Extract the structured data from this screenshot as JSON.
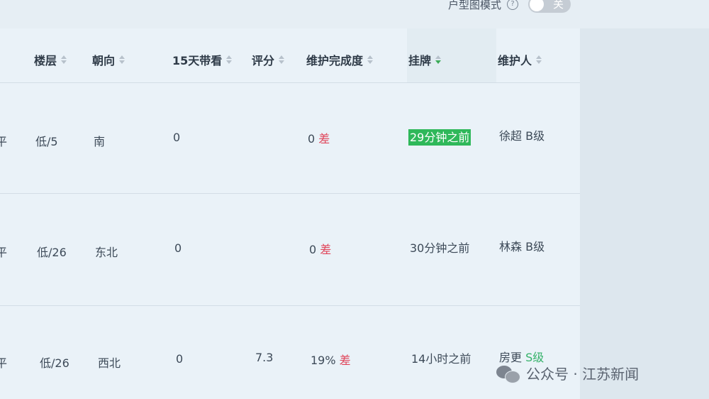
{
  "toolbar": {
    "floor_plan_mode_label": "户型图模式",
    "toggle_label": "关"
  },
  "table": {
    "headers": {
      "floor": "楼层",
      "orientation": "朝向",
      "views_15d": "15天带看",
      "score": "评分",
      "maintenance": "维护完成度",
      "listing": "挂牌",
      "maintainer": "维护人"
    },
    "rows": [
      {
        "left_fragment": "平",
        "floor": "低/5",
        "orientation": "南",
        "views_15d": "0",
        "score": "",
        "maint_value": "0",
        "maint_grade": "差",
        "listing": "29分钟之前",
        "maintainer_name": "徐超",
        "maintainer_grade": "B级"
      },
      {
        "left_fragment": "平",
        "floor": "低/26",
        "orientation": "东北",
        "views_15d": "0",
        "score": "",
        "maint_value": "0",
        "maint_grade": "差",
        "listing": "30分钟之前",
        "maintainer_name": "林森",
        "maintainer_grade": "B级"
      },
      {
        "left_fragment": "平",
        "floor": "低/26",
        "orientation": "西北",
        "views_15d": "0",
        "score": "7.3",
        "maint_value": "19%",
        "maint_grade": "差",
        "listing": "14小时之前",
        "maintainer_name": "房更",
        "maintainer_grade": "S级"
      }
    ]
  },
  "watermark": {
    "text": "公众号 · 江苏新闻"
  },
  "colors": {
    "bad": "#e0455a",
    "good": "#36b26a",
    "highlight": "#2fb85a"
  }
}
